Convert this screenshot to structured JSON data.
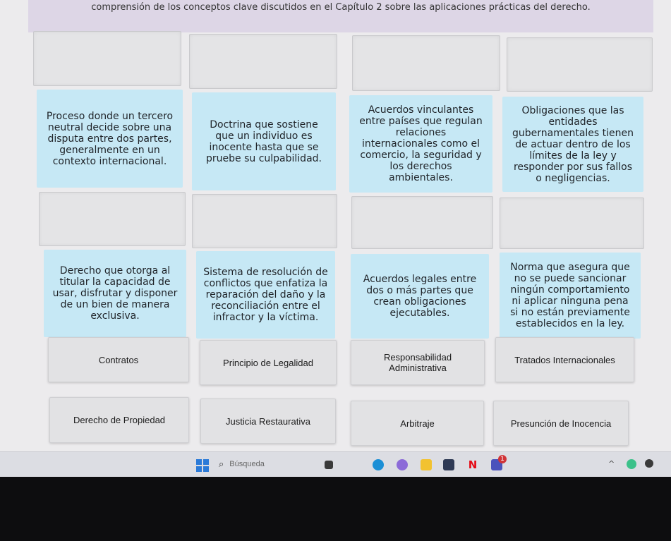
{
  "instruction": "comprensión de los conceptos clave discutidos en el Capítulo 2 sobre las aplicaciones prácticas del derecho.",
  "row1_definitions": [
    "Proceso donde un tercero neutral decide sobre una disputa entre dos partes, generalmente en un contexto internacional.",
    "Doctrina que sostiene que un individuo es inocente hasta que se pruebe su culpabilidad.",
    "Acuerdos vinculantes entre países que regulan relaciones internacionales como el comercio, la seguridad y los derechos ambientales.",
    "Obligaciones que las entidades gubernamentales tienen de actuar dentro de los límites de la ley y responder por sus fallos o negligencias."
  ],
  "row2_definitions": [
    "Derecho que otorga al titular la capacidad de usar, disfrutar y disponer de un bien de manera exclusiva.",
    "Sistema de resolución de conflictos que enfatiza la reparación del daño y la reconciliación entre el infractor y la víctima.",
    "Acuerdos legales entre dos o más partes que crean obligaciones ejecutables.",
    "Norma que asegura que no se puede sancionar ningún comportamiento ni aplicar ninguna pena si no están previamente establecidos en la ley."
  ],
  "terms_row1": [
    "Contratos",
    "Principio de Legalidad",
    "Responsabilidad Administrativa",
    "Tratados Internacionales"
  ],
  "terms_row2": [
    "Derecho de Propiedad",
    "Justicia Restaurativa",
    "Arbitraje",
    "Presunción de Inocencia"
  ],
  "taskbar": {
    "search_placeholder": "Búsqueda",
    "notification_badge": "1"
  },
  "colors": {
    "definition_bg": "#c6e8f5",
    "term_bg": "#e2e2e4",
    "banner_bg": "#ddd6e6"
  }
}
